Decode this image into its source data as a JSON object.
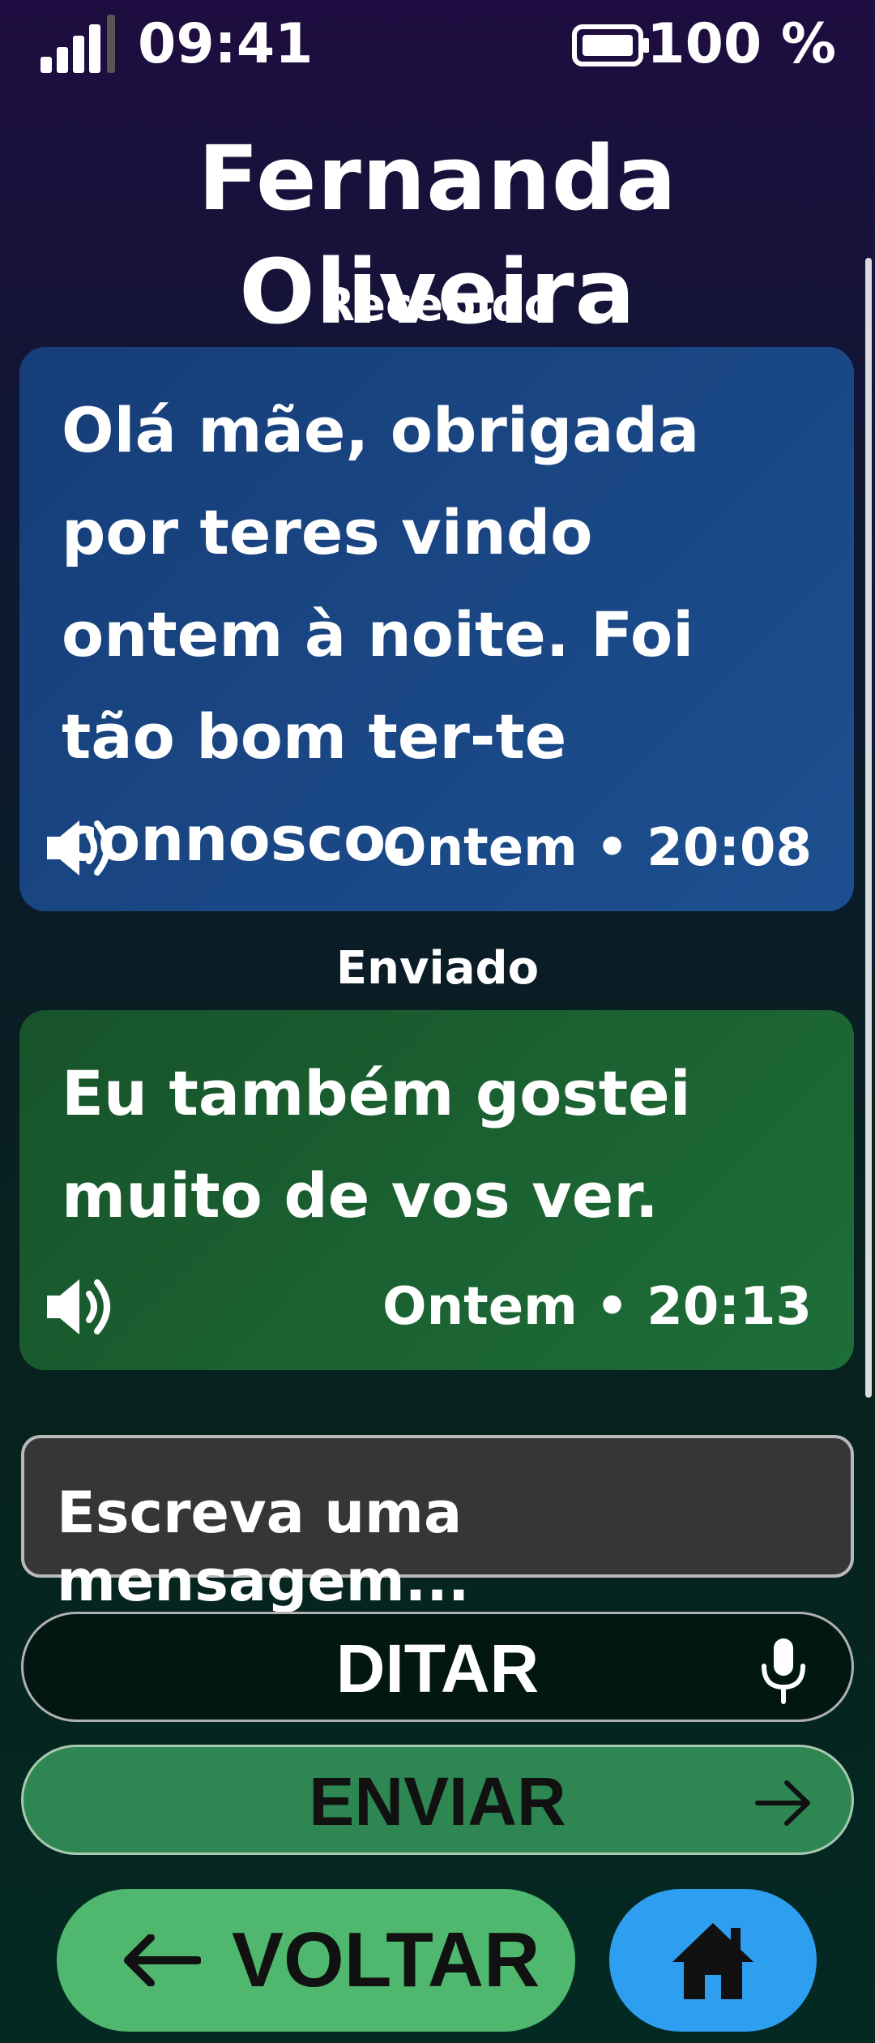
{
  "status_bar": {
    "time": "09:41",
    "battery_percent": "100 %",
    "signal_icon": "signal-bars-icon",
    "battery_icon": "battery-full-icon"
  },
  "contact": {
    "name": "Fernanda Oliveira"
  },
  "messages": [
    {
      "direction_label": "Recebido",
      "text": "Olá mãe, obrigada por teres vindo ontem à noite. Foi tão bom ter-te connosco.",
      "timestamp": "Ontem • 20:08",
      "color": "#1b4a88"
    },
    {
      "direction_label": "Enviado",
      "text": "Eu também gostei muito de vos ver.",
      "timestamp": "Ontem • 20:13",
      "color": "#1a6231"
    }
  ],
  "compose": {
    "placeholder": "Escreva uma mensagem..."
  },
  "buttons": {
    "dictate_label": "DITAR",
    "send_label": "ENVIAR",
    "back_label": "VOLTAR"
  },
  "colors": {
    "send_button": "#2e8652",
    "back_button": "#4fb86e",
    "home_button": "#2e9ef0"
  }
}
